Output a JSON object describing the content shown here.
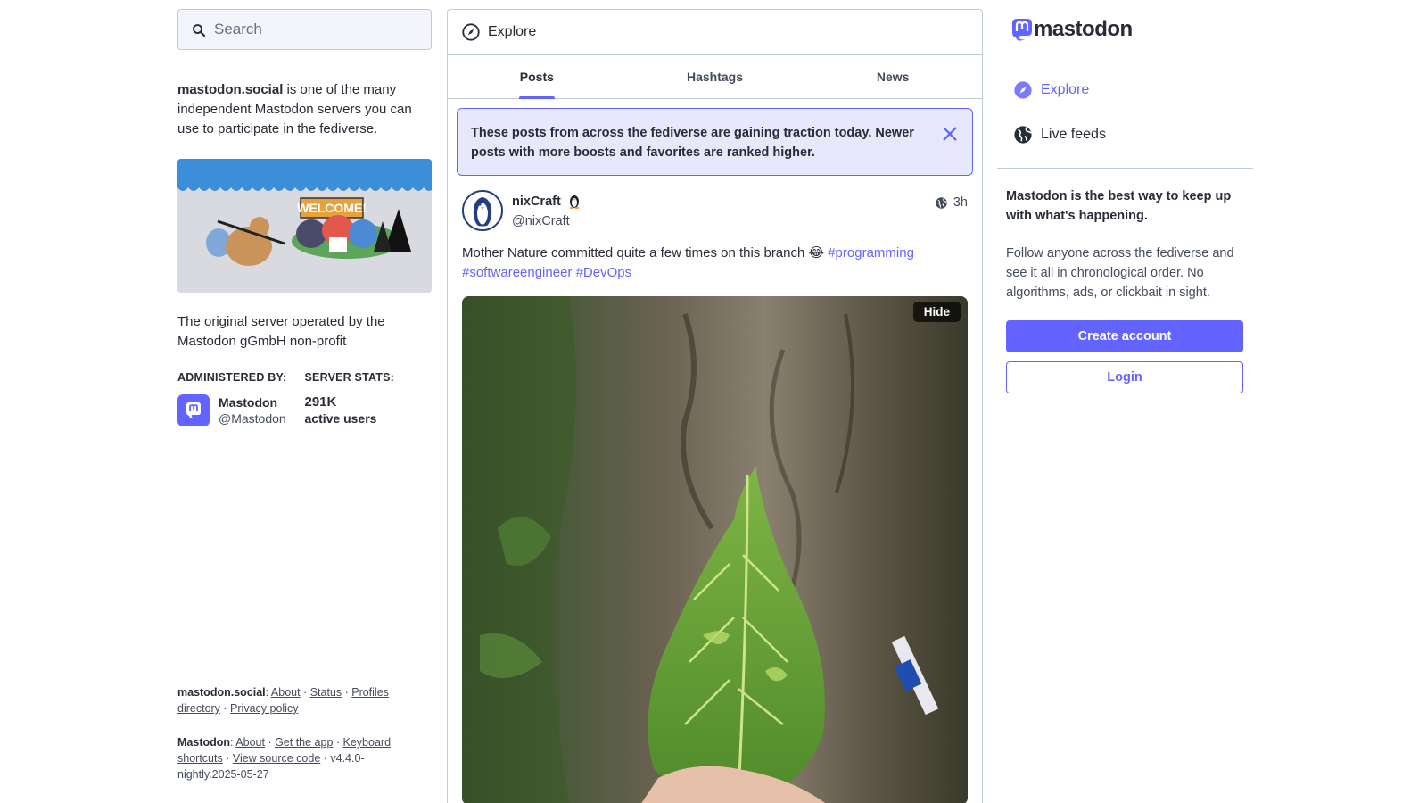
{
  "search": {
    "placeholder": "Search"
  },
  "server": {
    "domain": "mastodon.social",
    "intro_rest": " is one of the many independent Mastodon servers you can use to participate in the fediverse.",
    "banner_sign": "WELCOME!",
    "description": "The original server operated by the Mastodon gGmbH non-profit",
    "administered_label": "ADMINISTERED BY:",
    "stats_label": "SERVER STATS:",
    "admin_name": "Mastodon",
    "admin_handle": "@Mastodon",
    "active_users_value": "291K",
    "active_users_label": "active users"
  },
  "footer": {
    "server_name": "mastodon.social",
    "server_links": [
      "About",
      "Status",
      "Profiles directory",
      "Privacy policy"
    ],
    "app_name": "Mastodon",
    "app_links": [
      "About",
      "Get the app",
      "Keyboard shortcuts",
      "View source code"
    ],
    "version": "v4.4.0-nightly.2025-05-27"
  },
  "column": {
    "title": "Explore",
    "tabs": [
      {
        "label": "Posts",
        "active": true
      },
      {
        "label": "Hashtags",
        "active": false
      },
      {
        "label": "News",
        "active": false
      }
    ],
    "notice": "These posts from across the fediverse are gaining traction today. Newer posts with more boosts and favorites are ranked higher."
  },
  "post": {
    "display_name": "nixCraft",
    "username": "@nixCraft",
    "time": "3h",
    "text": "Mother Nature committed quite a few times on this branch",
    "emoji": "😂",
    "tags": [
      "#programming",
      "#softwareengineer",
      "#DevOps"
    ],
    "hide_label": "Hide"
  },
  "sidebar": {
    "logo_text": "mastodon",
    "nav": [
      {
        "label": "Explore",
        "icon": "compass-icon",
        "active": true
      },
      {
        "label": "Live feeds",
        "icon": "globe-icon",
        "active": false
      }
    ],
    "promo_heading": "Mastodon is the best way to keep up with what's happening.",
    "promo_text": "Follow anyone across the fediverse and see it all in chronological order. No algorithms, ads, or clickbait in sight.",
    "create_account": "Create account",
    "login": "Login"
  },
  "colors": {
    "accent": "#6364ff",
    "text": "#282c37",
    "muted": "#444b5d",
    "border": "#c0cdd9",
    "notice_bg": "#e8e8fd"
  }
}
